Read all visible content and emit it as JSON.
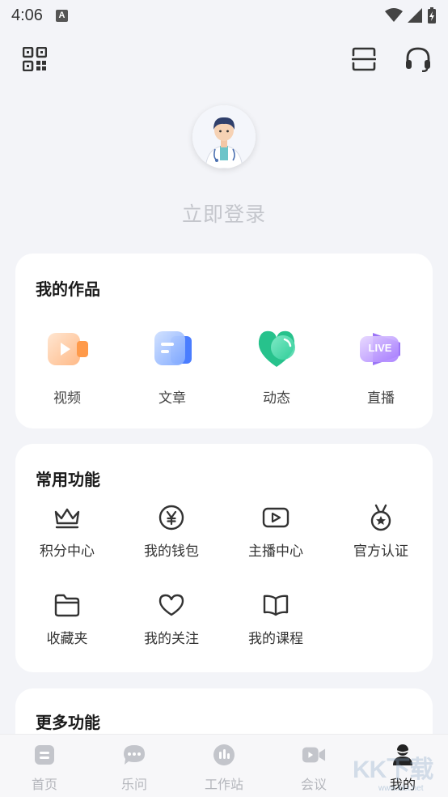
{
  "status_bar": {
    "time": "4:06",
    "notification_icon": "A"
  },
  "header": {
    "qr_icon": "qr-code-icon",
    "scan_icon": "scan-icon",
    "support_icon": "headset-icon"
  },
  "profile": {
    "login_label": "立即登录"
  },
  "my_works": {
    "title": "我的作品",
    "items": [
      {
        "label": "视频",
        "icon": "video-icon"
      },
      {
        "label": "文章",
        "icon": "article-icon"
      },
      {
        "label": "动态",
        "icon": "moments-icon"
      },
      {
        "label": "直播",
        "icon": "live-icon",
        "badge": "LIVE"
      }
    ]
  },
  "common_functions": {
    "title": "常用功能",
    "items": [
      {
        "label": "积分中心",
        "icon": "crown-icon"
      },
      {
        "label": "我的钱包",
        "icon": "yen-coin-icon"
      },
      {
        "label": "主播中心",
        "icon": "play-screen-icon"
      },
      {
        "label": "官方认证",
        "icon": "medal-icon"
      },
      {
        "label": "收藏夹",
        "icon": "folder-icon"
      },
      {
        "label": "我的关注",
        "icon": "heart-icon"
      },
      {
        "label": "我的课程",
        "icon": "book-icon"
      }
    ]
  },
  "more_functions": {
    "title": "更多功能"
  },
  "tab_bar": {
    "items": [
      {
        "label": "首页",
        "icon": "home-icon"
      },
      {
        "label": "乐问",
        "icon": "chat-icon"
      },
      {
        "label": "工作站",
        "icon": "workstation-icon"
      },
      {
        "label": "会议",
        "icon": "meeting-icon"
      },
      {
        "label": "我的",
        "icon": "profile-icon",
        "active": true
      }
    ]
  },
  "watermark": {
    "text": "KK下载",
    "url": "www.kkx.net"
  },
  "colors": {
    "background": "#f3f4f8",
    "card": "#ffffff",
    "tab_inactive": "#b4b6bc",
    "tab_active": "#222222",
    "login_text": "#c4c6cc"
  }
}
